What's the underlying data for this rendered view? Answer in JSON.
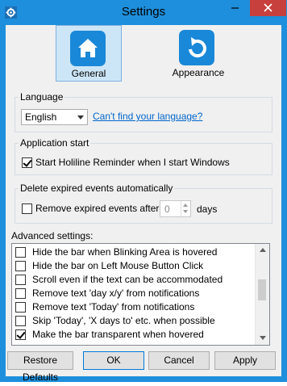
{
  "window": {
    "title": "Settings",
    "minimize_glyph": "—",
    "close_glyph": "✕"
  },
  "tabs": [
    {
      "label": "General",
      "icon": "home-icon",
      "selected": true
    },
    {
      "label": "Appearance",
      "icon": "refresh-icon",
      "selected": false
    }
  ],
  "language": {
    "group_title": "Language",
    "selected": "English",
    "link": "Can't find your language?"
  },
  "app_start": {
    "group_title": "Application start",
    "checkbox_label": "Start Holiline Reminder when I start Windows",
    "checked": true
  },
  "expired": {
    "group_title": "Delete expired events automatically",
    "checkbox_label": "Remove expired events after",
    "checked": false,
    "days_value": "0",
    "days_label": "days"
  },
  "advanced": {
    "label": "Advanced settings:",
    "items": [
      {
        "label": "Hide the bar when Blinking Area is hovered",
        "checked": false
      },
      {
        "label": "Hide the bar on Left Mouse Button Click",
        "checked": false
      },
      {
        "label": "Scroll even if the text can be accommodated",
        "checked": false
      },
      {
        "label": "Remove text 'day x/y' from notifications",
        "checked": false
      },
      {
        "label": "Remove text 'Today' from notifications",
        "checked": false
      },
      {
        "label": "Skip 'Today', 'X days to' etc. when possible",
        "checked": false
      },
      {
        "label": "Make the bar transparent when hovered",
        "checked": true
      }
    ]
  },
  "buttons": {
    "restore": "Restore Defaults",
    "ok": "OK",
    "cancel": "Cancel",
    "apply": "Apply"
  },
  "colors": {
    "titlebar": "#1e8fdc",
    "close": "#c8403d",
    "tab_icon_bg": "#1a88d8",
    "link": "#0066cc"
  }
}
